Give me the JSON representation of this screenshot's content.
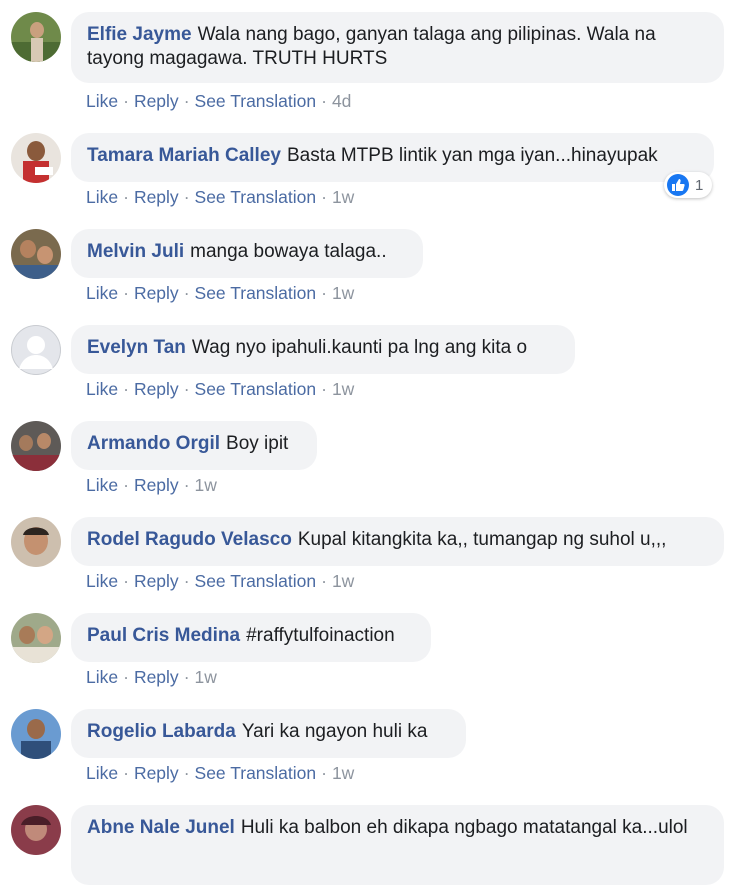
{
  "comments": [
    {
      "author": "Elfie Jayme",
      "text": "Wala nang bago, ganyan talaga ang pilipinas. Wala na tayong magagawa. TRUTH HURTS",
      "like": "Like",
      "reply": "Reply",
      "translate": "See Translation",
      "time": "4d"
    },
    {
      "author": "Tamara Mariah Calley",
      "text": "Basta MTPB lintik yan mga iyan...hinayupak",
      "like": "Like",
      "reply": "Reply",
      "translate": "See Translation",
      "time": "1w",
      "reaction_count": "1"
    },
    {
      "author": "Melvin Juli",
      "text": "manga bowaya talaga..",
      "like": "Like",
      "reply": "Reply",
      "translate": "See Translation",
      "time": "1w"
    },
    {
      "author": "Evelyn Tan",
      "text": "Wag nyo ipahuli.kaunti pa lng ang kita o",
      "like": "Like",
      "reply": "Reply",
      "translate": "See Translation",
      "time": "1w"
    },
    {
      "author": "Armando Orgil",
      "text": "Boy ipit",
      "like": "Like",
      "reply": "Reply",
      "time": "1w"
    },
    {
      "author": "Rodel Ragudo Velasco",
      "text": "Kupal kitangkita ka,, tumangap ng suhol u,,,",
      "like": "Like",
      "reply": "Reply",
      "translate": "See Translation",
      "time": "1w"
    },
    {
      "author": "Paul Cris Medina",
      "text": "#raffytulfoinaction",
      "like": "Like",
      "reply": "Reply",
      "time": "1w"
    },
    {
      "author": "Rogelio Labarda",
      "text": "Yari ka ngayon huli ka",
      "like": "Like",
      "reply": "Reply",
      "translate": "See Translation",
      "time": "1w"
    },
    {
      "author": "Abne Nale Junel",
      "text": "Huli ka balbon eh dikapa ngbago matatangal ka...ulol"
    }
  ],
  "colors": {
    "link": "#385898",
    "action": "#4b6ba3",
    "bubble": "#f2f3f5",
    "muted": "#8d949e",
    "like_blue": "#1877f2"
  },
  "icons": {
    "reaction": "like-thumb-icon",
    "avatar_placeholder": "default-avatar-icon"
  }
}
